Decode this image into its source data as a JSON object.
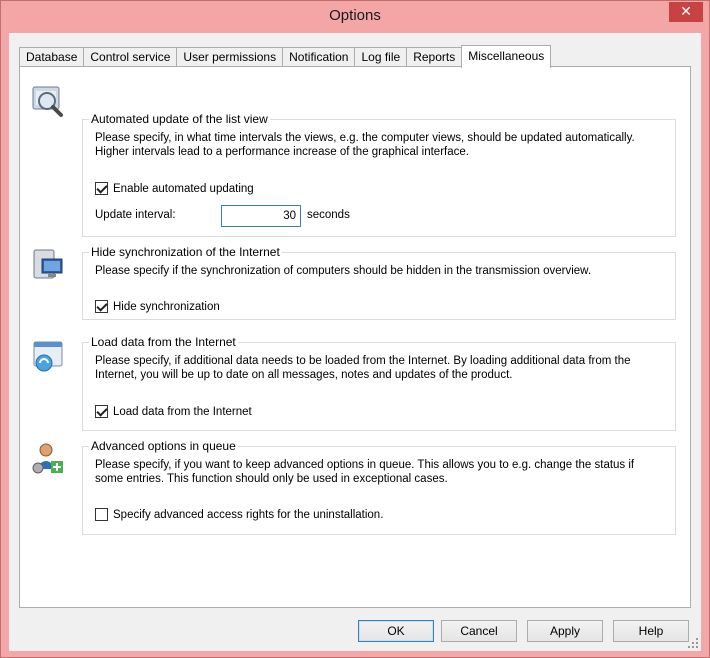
{
  "window": {
    "title": "Options",
    "close_label": "✕"
  },
  "tabs": [
    {
      "label": "Database"
    },
    {
      "label": "Control service"
    },
    {
      "label": "User permissions"
    },
    {
      "label": "Notification"
    },
    {
      "label": "Log file"
    },
    {
      "label": "Reports"
    },
    {
      "label": "Miscellaneous"
    }
  ],
  "active_tab": "Miscellaneous",
  "groups": {
    "auto_update": {
      "title": "Automated update of the list view",
      "description": "Please specify, in what time intervals the views, e.g. the computer views, should be updated automatically. Higher intervals lead to a performance increase of the graphical interface.",
      "checkbox_label": "Enable automated updating",
      "checked": true,
      "interval_label": "Update interval:",
      "interval_value": "30",
      "interval_unit": "seconds"
    },
    "hide_sync": {
      "title": "Hide synchronization of the Internet",
      "description": "Please specify if the synchronization of computers should be hidden in the transmission overview.",
      "checkbox_label": "Hide synchronization",
      "checked": true
    },
    "load_data": {
      "title": "Load data from the Internet",
      "description": "Please specify, if additional data needs to be loaded from the Internet. By loading additional data from the Internet, you will be up to date on all messages, notes and updates of the product.",
      "checkbox_label": "Load data from the Internet",
      "checked": true
    },
    "advanced_queue": {
      "title": "Advanced options in queue",
      "description": "Please specify, if you want to keep advanced options in queue. This allows you to e.g. change the status if some entries. This function should only be used in exceptional cases.",
      "checkbox_label": "Specify advanced access rights for the uninstallation.",
      "checked": false
    }
  },
  "buttons": {
    "ok": "OK",
    "cancel": "Cancel",
    "apply": "Apply",
    "help": "Help"
  },
  "icons": {
    "auto_update": "magnifier-refresh-icon",
    "hide_sync": "computer-sync-icon",
    "load_data": "internet-download-icon",
    "advanced_queue": "user-gear-add-icon"
  }
}
